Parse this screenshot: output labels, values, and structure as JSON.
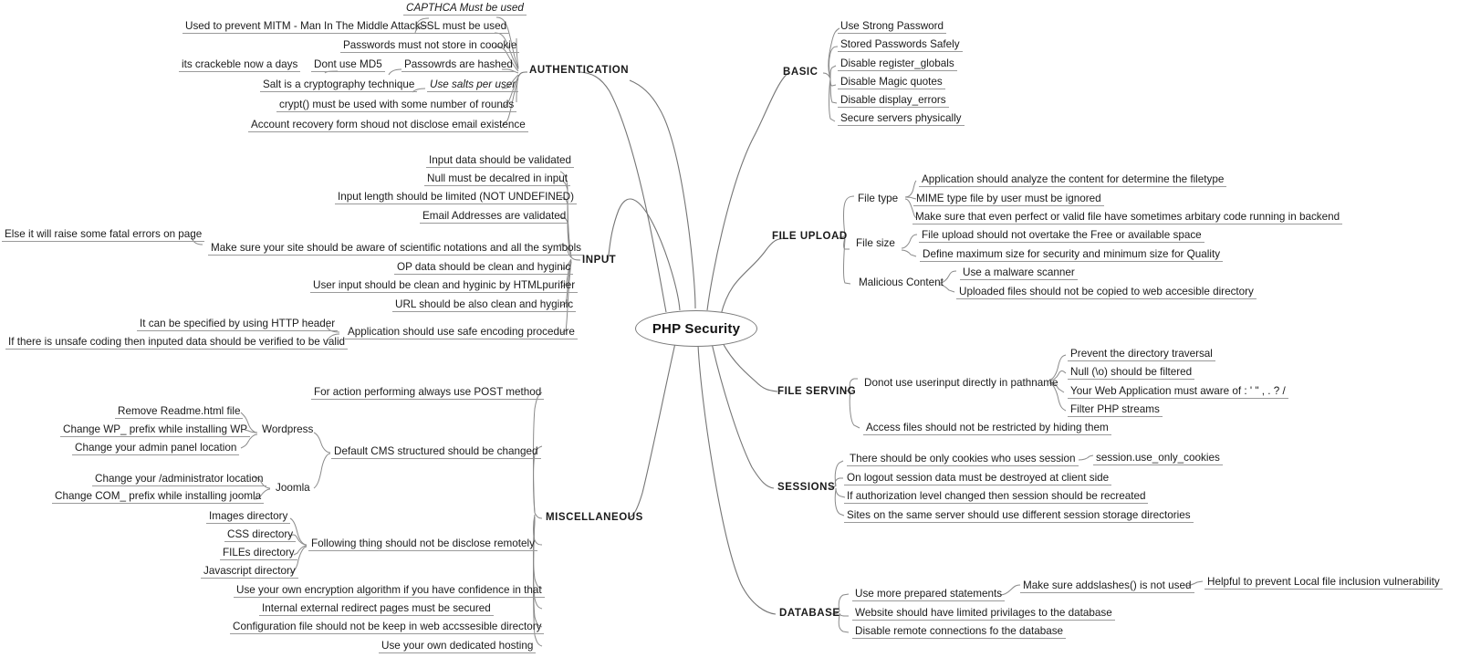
{
  "title": "PHP Security",
  "center": {
    "label": "PHP Security"
  },
  "branches": {
    "authentication": {
      "label": "AUTHENTICATION",
      "children": [
        {
          "label": "SSL must be used",
          "children": [
            {
              "label": "CAPTHCA Must be used",
              "style": "italic"
            },
            {
              "label": "Used to prevent MITM -  Man In The Middle Attack"
            }
          ]
        },
        {
          "label": "Passwords must not store in coookie"
        },
        {
          "label": "Passowrds are hashed",
          "children": [
            {
              "label": "Dont use MD5",
              "children": [
                {
                  "label": "its crackeble now a days"
                }
              ]
            }
          ]
        },
        {
          "label": "Use salts per user",
          "style": "italic",
          "children": [
            {
              "label": "Salt is a cryptography technique"
            }
          ]
        },
        {
          "label": "crypt() must be used with some number of rounds"
        },
        {
          "label": "Account recovery form shoud not disclose email existence"
        }
      ]
    },
    "basic": {
      "label": "BASIC",
      "children": [
        {
          "label": "Use Strong Password"
        },
        {
          "label": "Stored Passwords Safely"
        },
        {
          "label": "Disable register_globals"
        },
        {
          "label": "Disable Magic quotes"
        },
        {
          "label": "Disable display_errors"
        },
        {
          "label": "Secure servers physically"
        }
      ]
    },
    "input": {
      "label": "INPUT",
      "children": [
        {
          "label": "Input data should be validated"
        },
        {
          "label": "Null must be decalred in input"
        },
        {
          "label": "Input length should be limited (NOT UNDEFINED)"
        },
        {
          "label": "Email Addresses are validated"
        },
        {
          "label": "Make sure your site should be aware of scientific notations and all the symbols",
          "children": [
            {
              "label": "Else it will raise some fatal errors on page"
            }
          ]
        },
        {
          "label": "OP data should be clean and hyginic"
        },
        {
          "label": "User input should be clean and hyginic by HTMLpurifier"
        },
        {
          "label": "URL should be also clean and hyginic"
        },
        {
          "label": "Application should use safe encoding procedure",
          "children": [
            {
              "label": "It can be specified by using HTTP header"
            },
            {
              "label": "If there is unsafe coding then inputed data should be verified to be valid"
            }
          ]
        }
      ]
    },
    "file_upload": {
      "label": "FILE UPLOAD",
      "children": [
        {
          "label": "File type",
          "children": [
            {
              "label": "Application should analyze the content for determine the filetype"
            },
            {
              "label": "MIME type file by user must be ignored"
            },
            {
              "label": "Make sure that even perfect or valid file have sometimes arbitary code running in backend"
            }
          ]
        },
        {
          "label": "File size",
          "children": [
            {
              "label": "File upload should not overtake the Free or available space"
            },
            {
              "label": "Define maximum size for security and minimum size for Quality"
            }
          ]
        },
        {
          "label": "Malicious Content",
          "children": [
            {
              "label": "Use a malware scanner"
            },
            {
              "label": "Uploaded files should not be copied to web accesible directory"
            }
          ]
        }
      ]
    },
    "file_serving": {
      "label": "FILE SERVING",
      "children": [
        {
          "label": "Donot use userinput directly in pathname",
          "children": [
            {
              "label": "Prevent the directory traversal"
            },
            {
              "label": "Null (\\o) should be filtered"
            },
            {
              "label": "Your Web Application must aware of : ' \" , . ? /"
            },
            {
              "label": "Filter PHP streams"
            }
          ]
        },
        {
          "label": "Access files should not be restricted by hiding them"
        }
      ]
    },
    "sessions": {
      "label": "SESSIONS",
      "children": [
        {
          "label": "There should be only cookies who uses session",
          "children": [
            {
              "label": "session.use_only_cookies"
            }
          ]
        },
        {
          "label": "On logout session data must be destroyed at client side"
        },
        {
          "label": "If authorization level changed then session should be recreated"
        },
        {
          "label": "Sites on the same server should use different session storage directories"
        }
      ]
    },
    "database": {
      "label": "DATABASE",
      "children": [
        {
          "label": "Use more prepared statements",
          "children": [
            {
              "label": "Make sure addslashes() is not used",
              "children": [
                {
                  "label": "Helpful to prevent Local file inclusion vulnerability"
                }
              ]
            }
          ]
        },
        {
          "label": "Website should have limited privilages to the database"
        },
        {
          "label": "Disable remote connections fo the database"
        }
      ]
    },
    "miscellaneous": {
      "label": "MISCELLANEOUS",
      "children": [
        {
          "label": "For action performing always use POST method"
        },
        {
          "label": "Default CMS structured should be changed",
          "children": [
            {
              "label": "Wordpress",
              "children": [
                {
                  "label": "Remove Readme.html file"
                },
                {
                  "label": "Change WP_ prefix while installing WP"
                },
                {
                  "label": "Change your admin panel location"
                }
              ]
            },
            {
              "label": "Joomla",
              "children": [
                {
                  "label": "Change your /administrator location"
                },
                {
                  "label": "Change COM_ prefix while installing joomla"
                }
              ]
            }
          ]
        },
        {
          "label": "Following thing should not be disclose remotely",
          "children": [
            {
              "label": "Images directory"
            },
            {
              "label": "CSS directory"
            },
            {
              "label": "FILEs directory"
            },
            {
              "label": "Javascript directory"
            }
          ]
        },
        {
          "label": "Use your own encryption algorithm if you have confidence in that"
        },
        {
          "label": "Internal external redirect pages must be secured"
        },
        {
          "label": "Configuration file should not be keep in web accssesible directory"
        },
        {
          "label": "Use your own dedicated hosting"
        }
      ]
    }
  }
}
